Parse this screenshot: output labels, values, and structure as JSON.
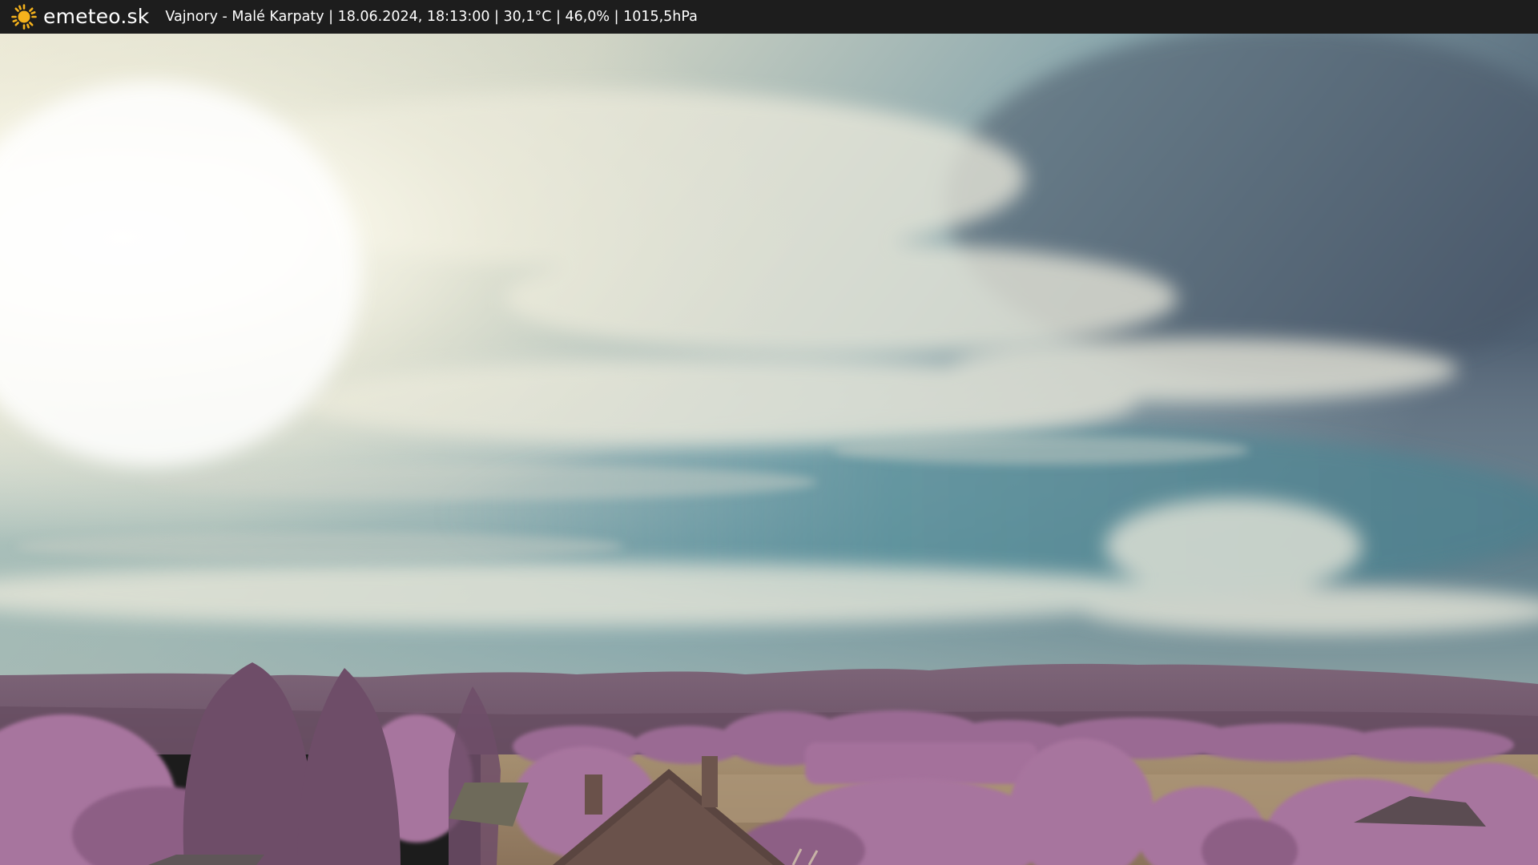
{
  "header": {
    "brand": "emeteo.sk",
    "brand_icon": "sun-icon",
    "station_info": "Vajnory - Malé Karpaty | 18.06.2024, 18:13:00 | 30,1°C | 46,0% | 1015,5hPa"
  },
  "colors": {
    "bar_background": "#1d1d1d",
    "sun_icon": "#f5b21c",
    "sky_bright": "#fbf7e6",
    "sky_teal": "#5b8f9a",
    "sky_dark": "#4a5a6e",
    "hills": "#7a5f74",
    "foliage": "#a06f98",
    "field": "#9b8567"
  }
}
